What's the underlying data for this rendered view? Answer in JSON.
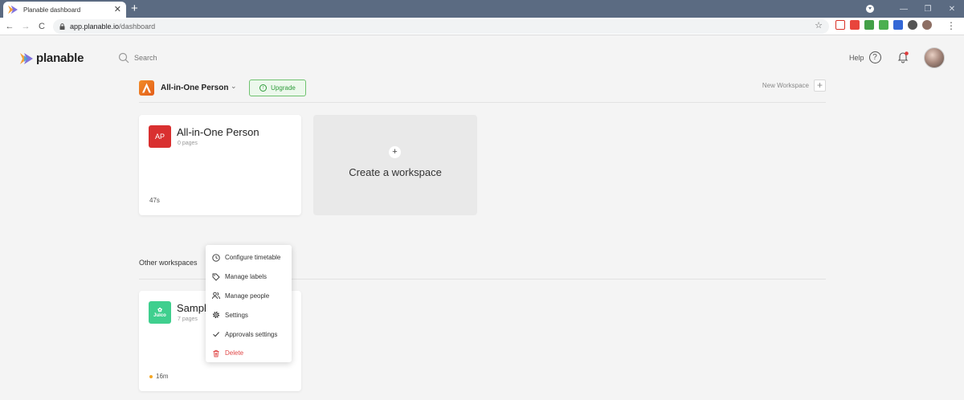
{
  "browser": {
    "tab_title": "Planable dashboard",
    "tab_close": "✕",
    "new_tab": "+",
    "url_host": "app.planable.io",
    "url_path": "/dashboard",
    "window_controls": [
      "—",
      "❐",
      "✕"
    ],
    "menu_glyph": "⋮",
    "star_glyph": "☆",
    "nav": {
      "back": "←",
      "forward": "→",
      "reload": "C"
    },
    "extension_colors": [
      "#d93025",
      "#e8453c",
      "#43a047",
      "#4caf50",
      "#3367d6",
      "#555555",
      "#8d6e63"
    ]
  },
  "header": {
    "logo_text": "planable",
    "search_placeholder": "Search",
    "help_label": "Help",
    "help_glyph": "?"
  },
  "workspace": {
    "name": "All-in-One Person",
    "chevron": "⌄",
    "upgrade_label": "Upgrade",
    "upgrade_glyph": "↑",
    "new_workspace_label": "New Workspace",
    "new_workspace_glyph": "+"
  },
  "cards": {
    "main": {
      "avatar": "AP",
      "title": "All-in-One Person",
      "subtitle": "0 pages",
      "time": "47s",
      "color": "#d93030"
    },
    "create": {
      "plus": "+",
      "label": "Create a workspace"
    },
    "sample": {
      "avatar": "Juico",
      "title": "Sampl",
      "subtitle": "7 pages",
      "time": "16m",
      "color": "#3fcf8e"
    }
  },
  "other_section": {
    "heading": "Other workspaces"
  },
  "context_menu": {
    "items": [
      {
        "label": "Configure timetable",
        "icon": "clock-icon"
      },
      {
        "label": "Manage labels",
        "icon": "tag-icon"
      },
      {
        "label": "Manage people",
        "icon": "people-icon"
      },
      {
        "label": "Settings",
        "icon": "gear-icon"
      },
      {
        "label": "Approvals settings",
        "icon": "check-icon"
      },
      {
        "label": "Delete",
        "icon": "trash-icon",
        "danger": true
      }
    ]
  }
}
